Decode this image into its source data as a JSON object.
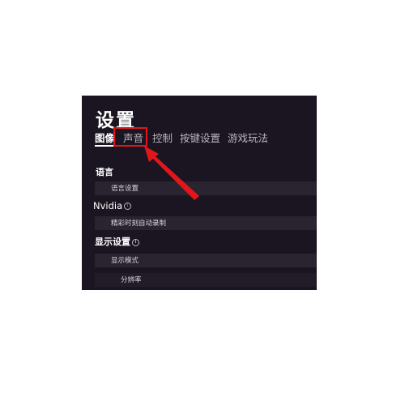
{
  "window": {
    "title": "设置"
  },
  "tabs": [
    {
      "label": "图像"
    },
    {
      "label": "声音"
    },
    {
      "label": "控制"
    },
    {
      "label": "按键设置"
    },
    {
      "label": "游戏玩法"
    }
  ],
  "sections": {
    "language": {
      "title": "语言",
      "row_label": "语言设置"
    },
    "nvidia": {
      "title": "Nvidia",
      "row_label": "精彩时刻自动录制"
    },
    "display": {
      "title": "显示设置",
      "row_label": "显示模式",
      "sub_row_label": "分辨率"
    }
  },
  "annotation": {
    "highlight_color": "#e0161b",
    "icon": "info-icon"
  },
  "colors": {
    "panel_bg": "#1b1521",
    "row_bg": "#2a2430",
    "highlight": "#e0161b"
  }
}
